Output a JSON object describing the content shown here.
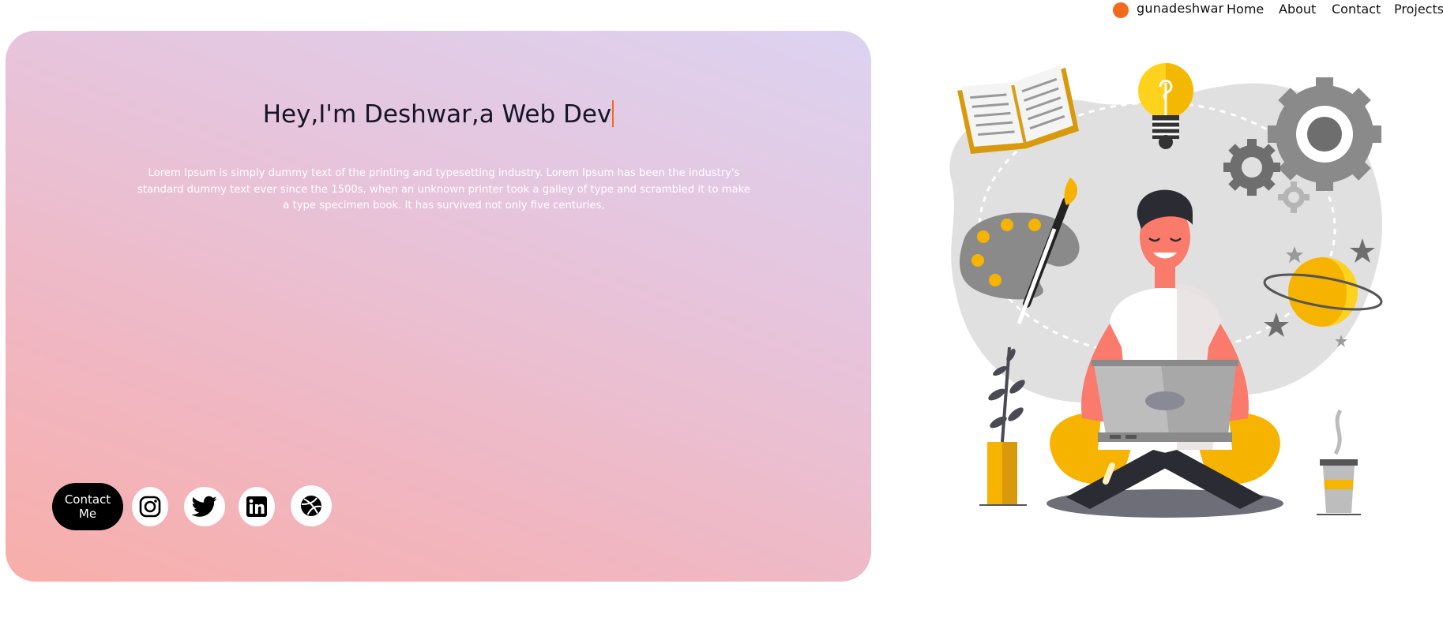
{
  "nav": {
    "brand": "gunadeshwar",
    "links": [
      "Home",
      "About",
      "Contact",
      "Projects"
    ]
  },
  "hero": {
    "title": "Hey,I'm Deshwar,a Web Dev",
    "description": "Lorem Ipsum is simply dummy text of the printing and typesetting industry. Lorem Ipsum has been the industry's standard dummy text ever since the 1500s, when an unknown printer took a galley of type and scrambled it to make a type specimen book. It has survived not only five centuries,",
    "contact_label": "Contact Me",
    "socials": [
      "instagram-icon",
      "twitter-icon",
      "linkedin-icon",
      "dribbble-icon"
    ]
  },
  "colors": {
    "accent": "#f26b1d",
    "gradient_top": "#dcd3f1",
    "gradient_bottom": "#f8aeaa"
  }
}
